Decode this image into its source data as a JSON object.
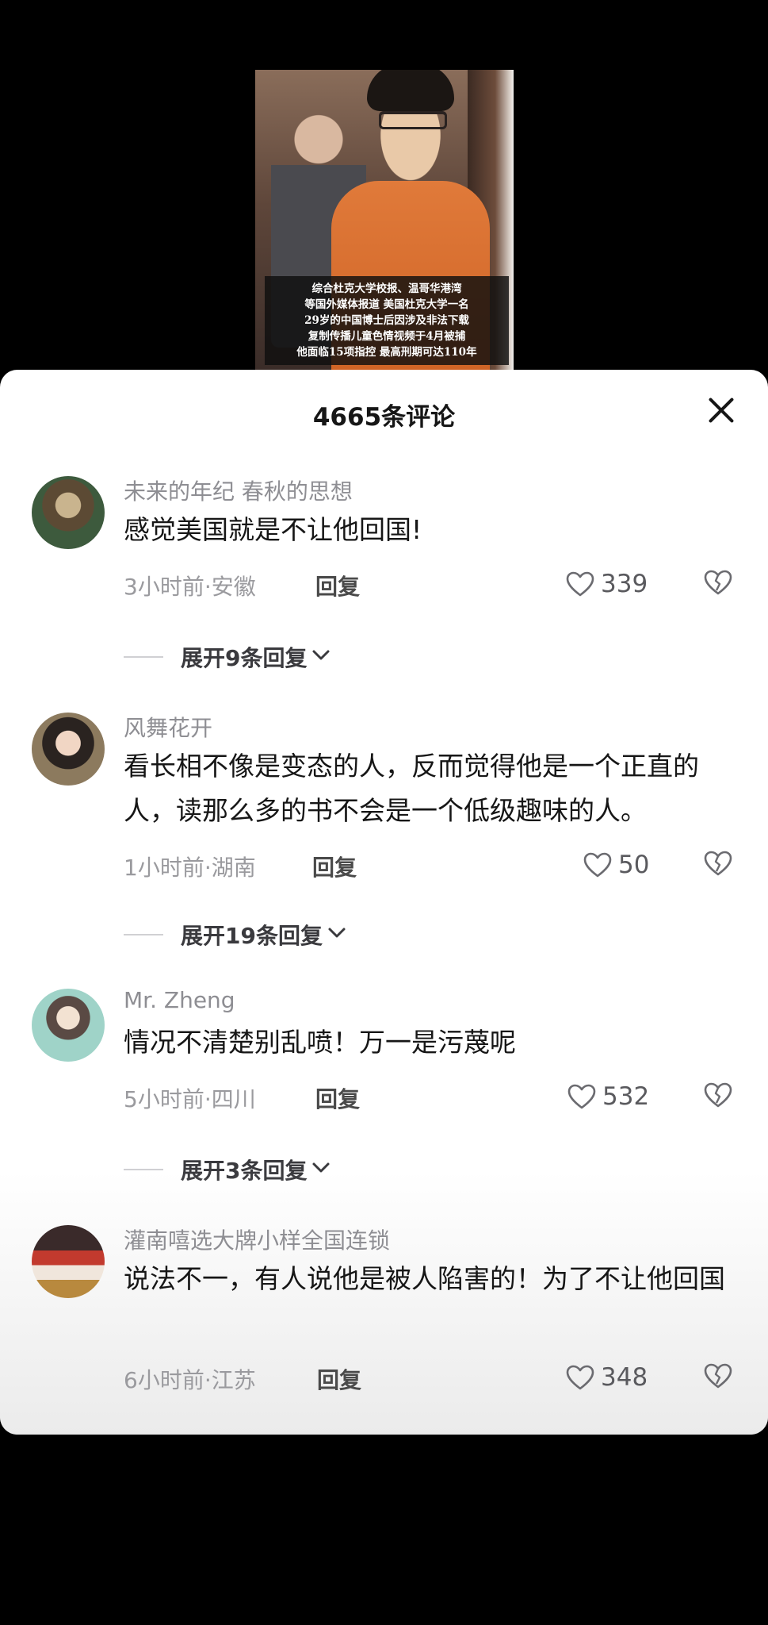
{
  "video": {
    "caption_lines": [
      "综合杜克大学校报、温哥华港湾",
      "等国外媒体报道 美国杜克大学一名",
      "29岁的中国博士后因涉及非法下载",
      "复制传播儿童色情视频于4月被捕",
      "他面临15项指控 最高刑期可达110年"
    ]
  },
  "header": {
    "title": "4665条评论"
  },
  "comments": [
    {
      "username": "未来的年纪  春秋的思想",
      "content": "感觉美国就是不让他回国!",
      "meta": "3小时前·安徽",
      "reply_label": "回复",
      "likes": "339",
      "expand_label": "展开9条回复"
    },
    {
      "username": "风舞花开",
      "content": "看长相不像是变态的人，反而觉得他是一个正直的人，读那么多的书不会是一个低级趣味的人。",
      "meta": "1小时前·湖南",
      "reply_label": "回复",
      "likes": "50",
      "expand_label": "展开19条回复"
    },
    {
      "username": "Mr. Zheng",
      "content": "情况不清楚别乱喷！万一是污蔑呢",
      "meta": "5小时前·四川",
      "reply_label": "回复",
      "likes": "532",
      "expand_label": "展开3条回复"
    },
    {
      "username": "灌南嘻选大牌小样全国连锁",
      "content": "说法不一，有人说他是被人陷害的！为了不让他回国",
      "meta": "6小时前·江苏",
      "reply_label": "回复",
      "likes": "348"
    }
  ],
  "icons": {
    "close": "close-icon",
    "like": "heart-outline-icon",
    "dislike": "broken-heart-icon",
    "expand": "chevron-down-icon"
  },
  "colors": {
    "sheet_bg": "#ffffff",
    "secondary_text": "#8e8e93",
    "primary_text": "#161616"
  }
}
